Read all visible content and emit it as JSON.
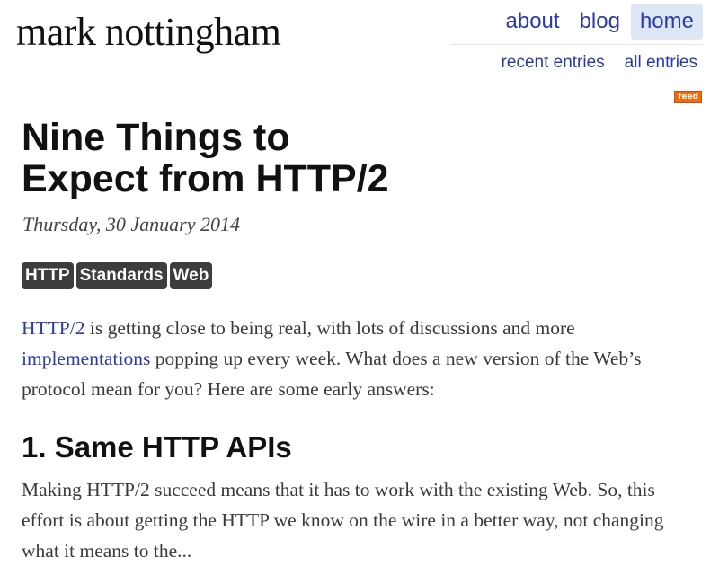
{
  "site": {
    "title": "mark nottingham"
  },
  "nav": {
    "main": [
      {
        "label": "about",
        "active": false
      },
      {
        "label": "blog",
        "active": false
      },
      {
        "label": "home",
        "active": true
      }
    ],
    "sub": [
      {
        "label": "recent entries"
      },
      {
        "label": "all entries"
      }
    ],
    "feed_badge": "feed"
  },
  "post": {
    "title_line1": "Nine Things to",
    "title_line2": "Expect from HTTP/2",
    "date": "Thursday, 30 January 2014",
    "tags": [
      "HTTP",
      "Standards",
      "Web"
    ],
    "intro": {
      "link1": "HTTP/2",
      "text1": " is getting close to being real, with lots of discussions and more ",
      "link2": "implementations",
      "text2": " popping up every week. What does a new version of the Web’s protocol mean for you? Here are some early answers:"
    },
    "section1": {
      "heading": "1. Same HTTP APIs",
      "body": "Making HTTP/2 succeed means that it has to work with the existing Web. So, this effort is about getting the HTTP we know on the wire in a better way, not changing what it means to the..."
    }
  },
  "colors": {
    "link": "#2a3aa8",
    "nav_active_bg": "#dde7f4",
    "tag_bg": "#3d3d3d",
    "feed_badge": "#f26b0a"
  }
}
